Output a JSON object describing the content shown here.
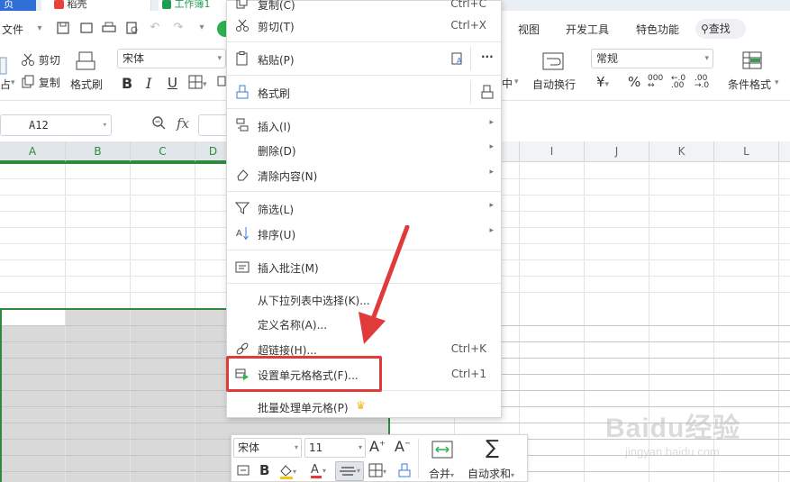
{
  "title_tabs": {
    "home_partial": "页",
    "doc_partial": "稻壳",
    "book_partial": "工作簿1"
  },
  "menubar": {
    "file": "文件",
    "tabs_right": [
      "视图",
      "开发工具",
      "特色功能"
    ],
    "search": "查找"
  },
  "ribbon": {
    "cut": "剪切",
    "copy": "复制",
    "format_painter": "格式刷",
    "paste_partial": "占",
    "font_name": "宋体",
    "bold": "B",
    "italic": "I",
    "underline": "U",
    "merge_partial": "中",
    "wrap": "自动换行",
    "number_format": "常规",
    "currency": "¥",
    "percent": "%",
    "conditional": "条件格式"
  },
  "formula_bar": {
    "cell_ref": "A12",
    "fx": "fx"
  },
  "columns": [
    "A",
    "B",
    "C",
    "D",
    "I",
    "J",
    "K",
    "L"
  ],
  "context_menu": {
    "items": [
      {
        "icon": "copy-icon",
        "label": "复制(C)",
        "shortcut": "Ctrl+C"
      },
      {
        "icon": "cut-icon",
        "label": "剪切(T)",
        "shortcut": "Ctrl+X"
      },
      {
        "icon": "paste-icon",
        "label": "粘贴(P)",
        "shortcut": ""
      },
      {
        "icon": "format-painter-icon",
        "label": "格式刷",
        "shortcut": ""
      },
      {
        "icon": "insert-icon",
        "label": "插入(I)",
        "shortcut": ""
      },
      {
        "icon": "",
        "label": "删除(D)",
        "shortcut": ""
      },
      {
        "icon": "eraser-icon",
        "label": "清除内容(N)",
        "shortcut": ""
      },
      {
        "icon": "filter-icon",
        "label": "筛选(L)",
        "shortcut": ""
      },
      {
        "icon": "sort-icon",
        "label": "排序(U)",
        "shortcut": ""
      },
      {
        "icon": "comment-icon",
        "label": "插入批注(M)",
        "shortcut": ""
      },
      {
        "icon": "",
        "label": "从下拉列表中选择(K)...",
        "shortcut": ""
      },
      {
        "icon": "",
        "label": "定义名称(A)...",
        "shortcut": ""
      },
      {
        "icon": "link-icon",
        "label": "超链接(H)...",
        "shortcut": "Ctrl+K"
      },
      {
        "icon": "format-cells-icon",
        "label": "设置单元格格式(F)...",
        "shortcut": "Ctrl+1"
      },
      {
        "icon": "",
        "label": "批量处理单元格(P)",
        "shortcut": ""
      }
    ],
    "paste_more": "···",
    "highlight_color": "#e03a3a"
  },
  "mini_toolbar": {
    "font": "宋体",
    "size": "11",
    "bold": "B",
    "merge": "合并",
    "autosum": "自动求和"
  },
  "watermark": {
    "main": "Baidu经验",
    "sub": "jingyan.baidu.com"
  },
  "colors": {
    "accent_green": "#2e8b3d",
    "selection_fill": "#d9d9d9",
    "arrow_red": "#e03a3a"
  }
}
